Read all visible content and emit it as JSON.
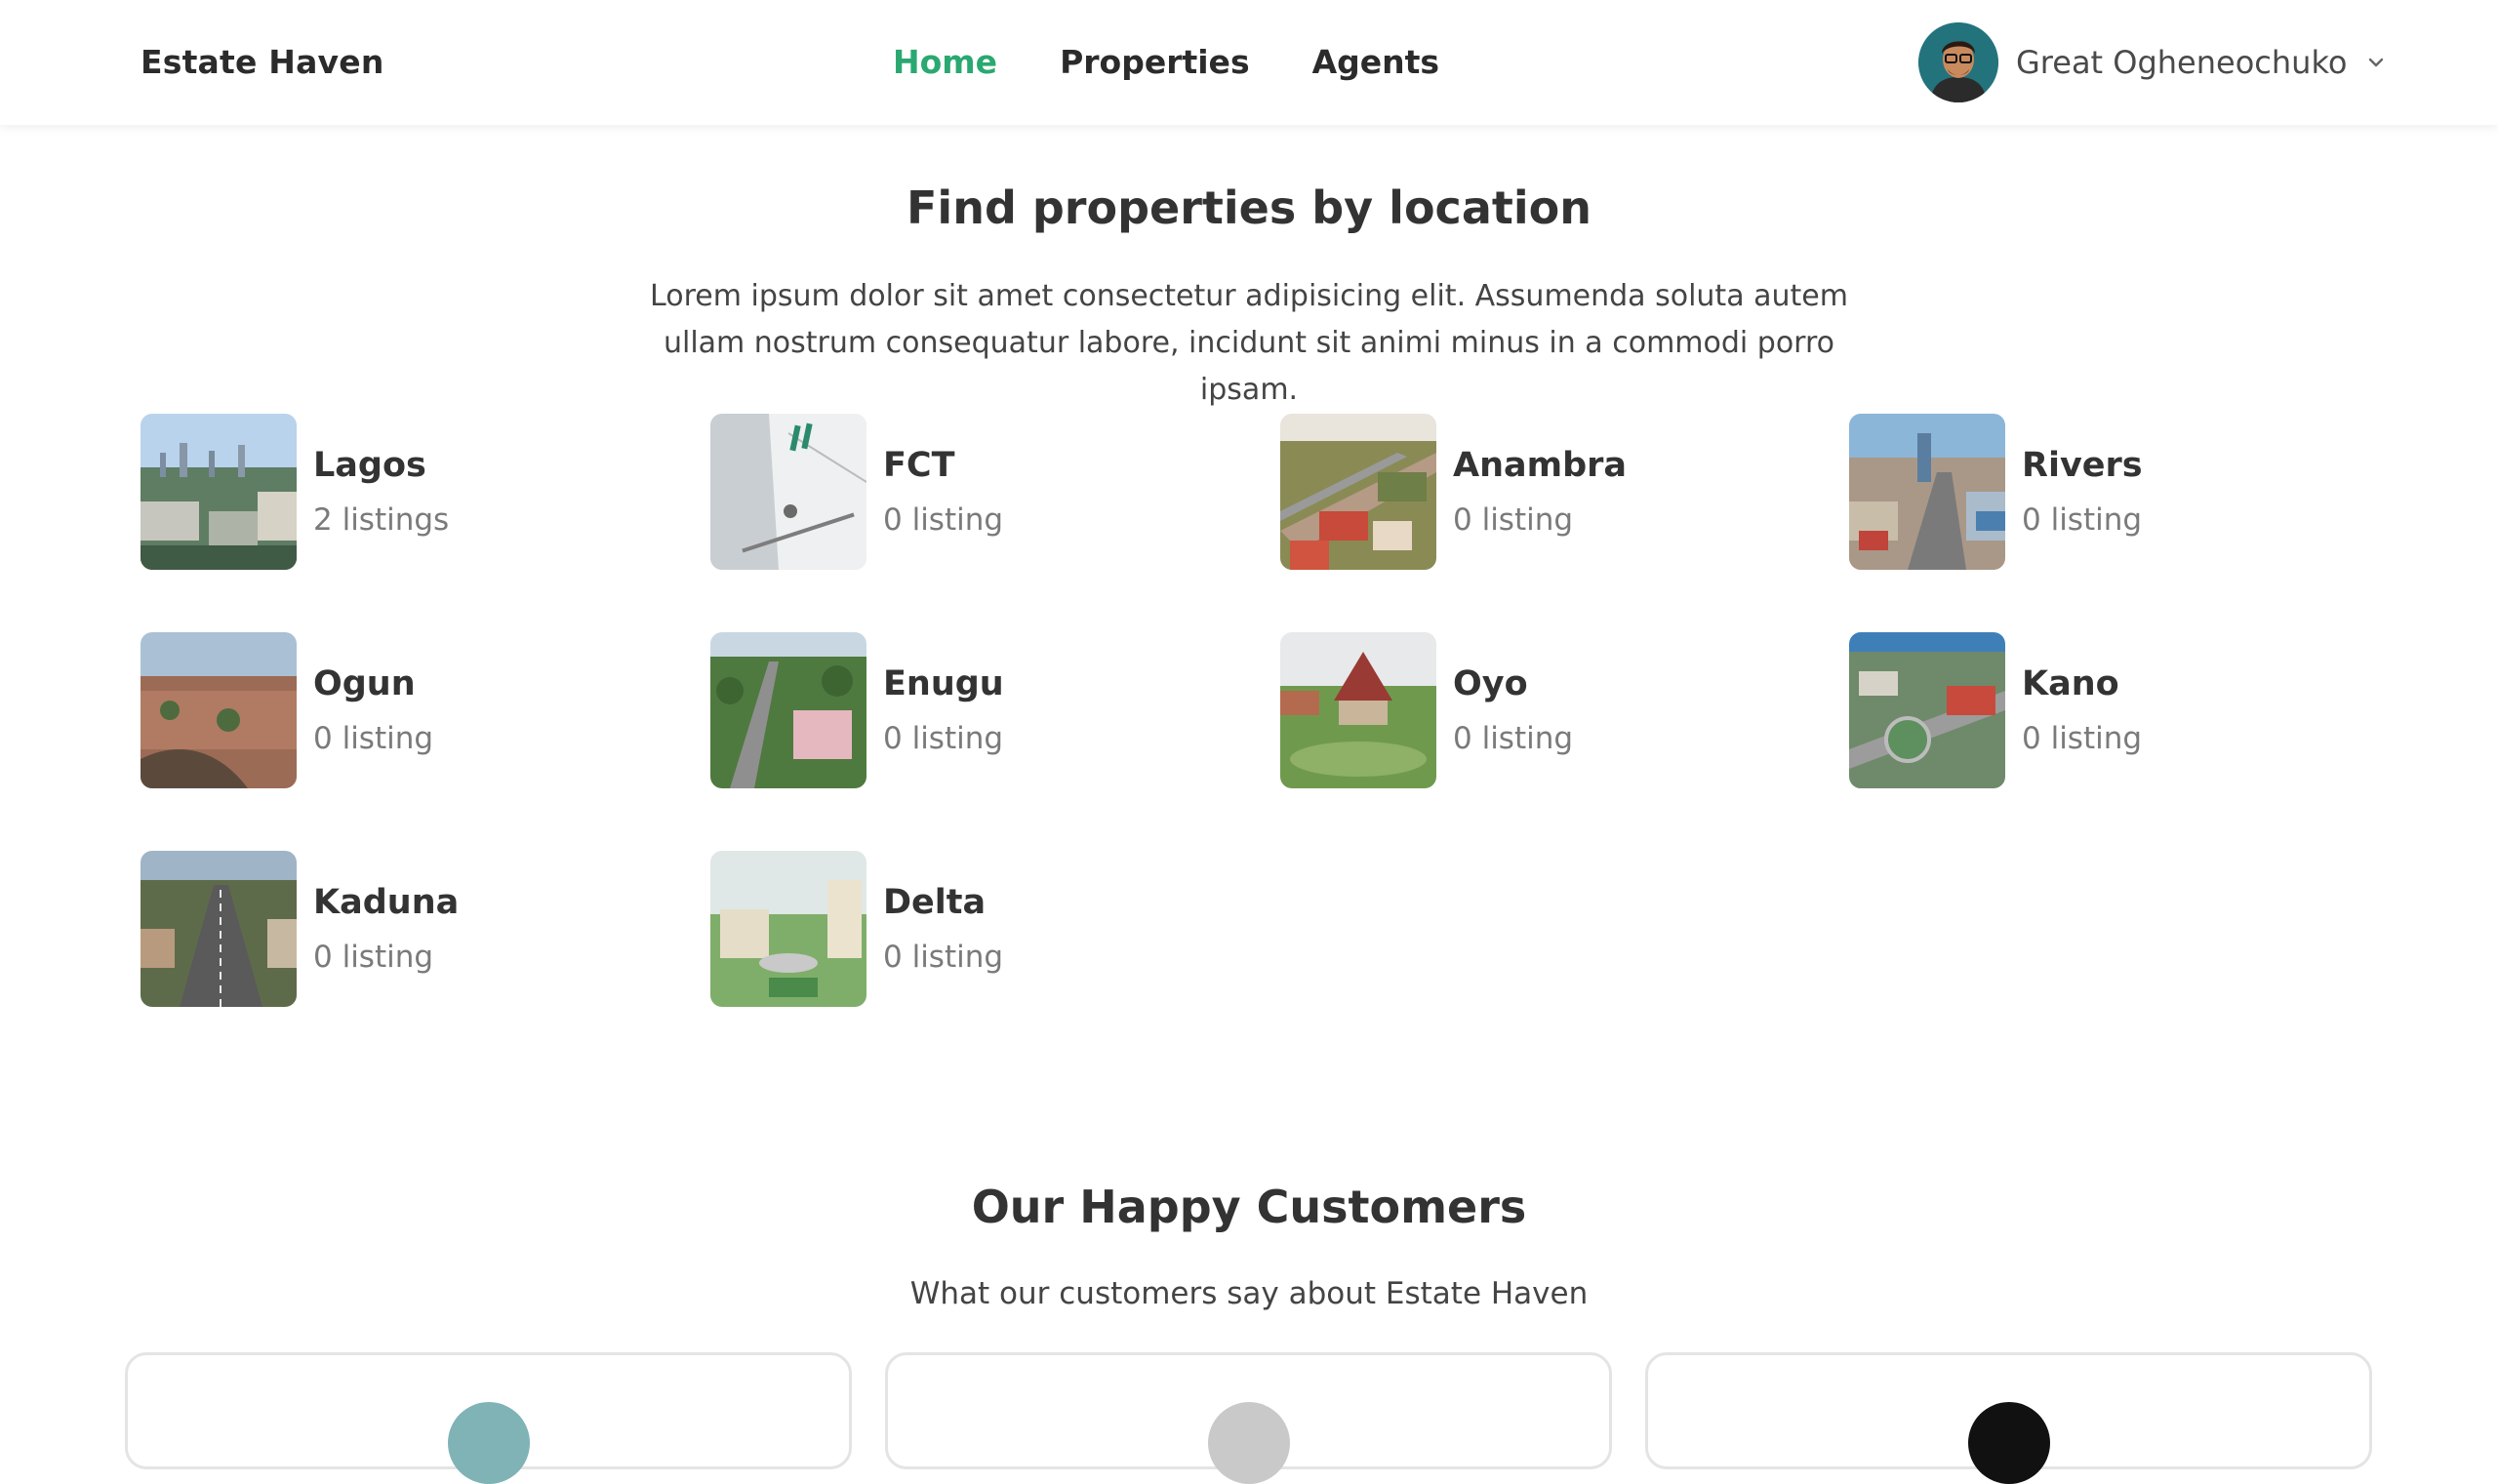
{
  "header": {
    "brand": "Estate Haven",
    "nav": [
      {
        "label": "Home",
        "active": true
      },
      {
        "label": "Properties",
        "active": false
      },
      {
        "label": "Agents",
        "active": false
      }
    ],
    "user": {
      "name": "Great Ogheneochuko",
      "avatar_icon": "user-avatar",
      "dropdown_icon": "chevron-down-icon"
    }
  },
  "locations": {
    "title": "Find properties by location",
    "description": "Lorem ipsum dolor sit amet consectetur adipisicing elit. Assumenda soluta autem ullam nostrum consequatur labore, incidunt sit animi minus in a commodi porro ipsam.",
    "items": [
      {
        "name": "Lagos",
        "count": "2 listings"
      },
      {
        "name": "FCT",
        "count": "0 listing"
      },
      {
        "name": "Anambra",
        "count": "0 listing"
      },
      {
        "name": "Rivers",
        "count": "0 listing"
      },
      {
        "name": "Ogun",
        "count": "0 listing"
      },
      {
        "name": "Enugu",
        "count": "0 listing"
      },
      {
        "name": "Oyo",
        "count": "0 listing"
      },
      {
        "name": "Kano",
        "count": "0 listing"
      },
      {
        "name": "Kaduna",
        "count": "0 listing"
      },
      {
        "name": "Delta",
        "count": "0 listing"
      }
    ]
  },
  "customers": {
    "title": "Our Happy Customers",
    "subtitle": "What our customers say about Estate Haven"
  },
  "colors": {
    "accent": "#2aa871",
    "text": "#333333",
    "muted": "#7a7a7a"
  }
}
